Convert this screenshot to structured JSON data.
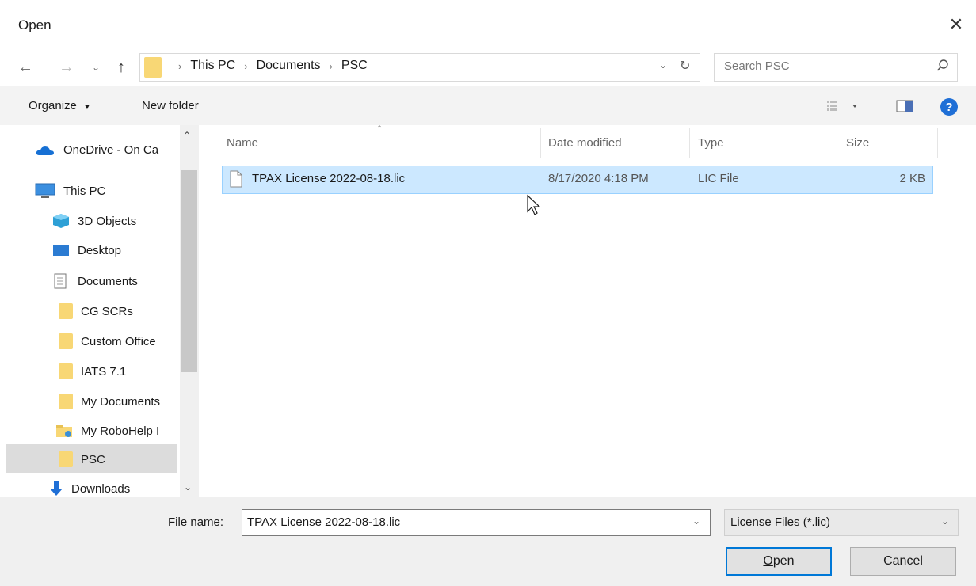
{
  "title": "Open",
  "address": {
    "crumbs": [
      "This PC",
      "Documents",
      "PSC"
    ],
    "search_placeholder": "Search PSC"
  },
  "toolbar": {
    "organize": "Organize",
    "new_folder": "New folder"
  },
  "nav": {
    "items": [
      {
        "label": "OneDrive - On Ca",
        "icon": "cloud-icon"
      },
      {
        "label": "This PC",
        "icon": "computer-icon"
      },
      {
        "label": "3D Objects",
        "icon": "3d-objects-icon"
      },
      {
        "label": "Desktop",
        "icon": "desktop-icon"
      },
      {
        "label": "Documents",
        "icon": "documents-icon"
      },
      {
        "label": "CG SCRs",
        "icon": "folder-icon"
      },
      {
        "label": "Custom Office",
        "icon": "folder-icon"
      },
      {
        "label": "IATS 7.1",
        "icon": "folder-icon"
      },
      {
        "label": "My Documents",
        "icon": "folder-icon"
      },
      {
        "label": "My RoboHelp I",
        "icon": "shared-folder-icon"
      },
      {
        "label": "PSC",
        "icon": "folder-icon"
      },
      {
        "label": "Downloads",
        "icon": "download-icon"
      }
    ]
  },
  "list": {
    "columns": [
      "Name",
      "Date modified",
      "Type",
      "Size"
    ],
    "rows": [
      {
        "name": "TPAX License 2022-08-18.lic",
        "date": "8/17/2020 4:18 PM",
        "type": "LIC File",
        "size": "2 KB"
      }
    ]
  },
  "bottom": {
    "file_name_label": "File name:",
    "file_name_label_mnemonic": "n",
    "file_name_value": "TPAX License 2022-08-18.lic",
    "file_type_value": "License Files (*.lic)",
    "open_label": "Open",
    "cancel_label": "Cancel"
  }
}
